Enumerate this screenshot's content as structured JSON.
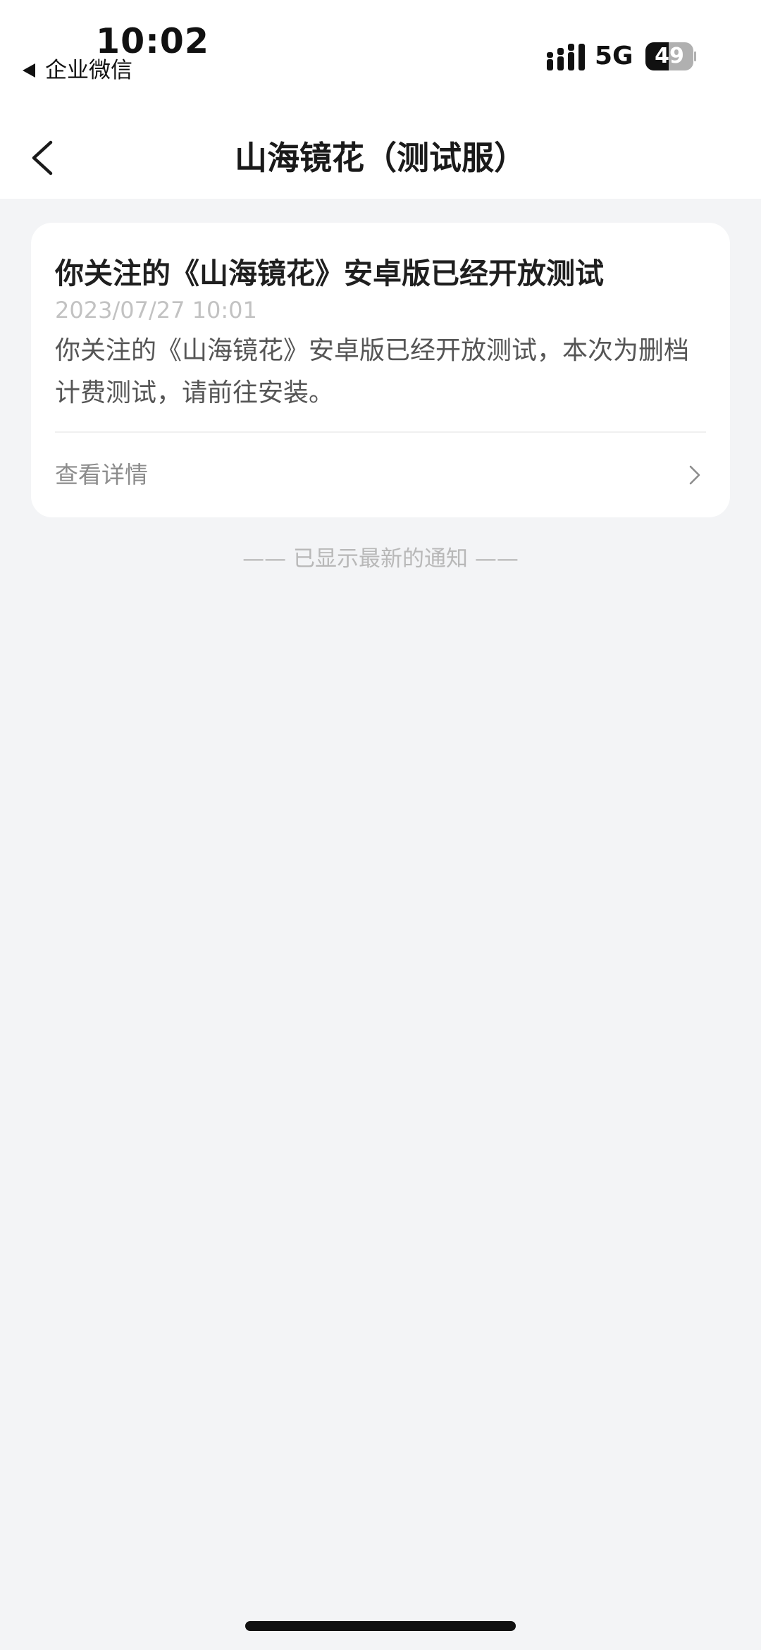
{
  "status_bar": {
    "time": "10:02",
    "back_app": "企业微信",
    "network": "5G",
    "battery": "49"
  },
  "nav": {
    "title": "山海镜花（测试服）"
  },
  "message": {
    "title": "你关注的《山海镜花》安卓版已经开放测试",
    "time": "2023/07/27 10:01",
    "body": "你关注的《山海镜花》安卓版已经开放测试，本次为删档计费测试，请前往安装。",
    "link_label": "查看详情"
  },
  "end_hint": "—— 已显示最新的通知 ——",
  "icons": {
    "back": "chevron-left-icon",
    "detail": "chevron-right-icon",
    "signal": "cellular-signal-icon",
    "battery": "battery-icon"
  }
}
